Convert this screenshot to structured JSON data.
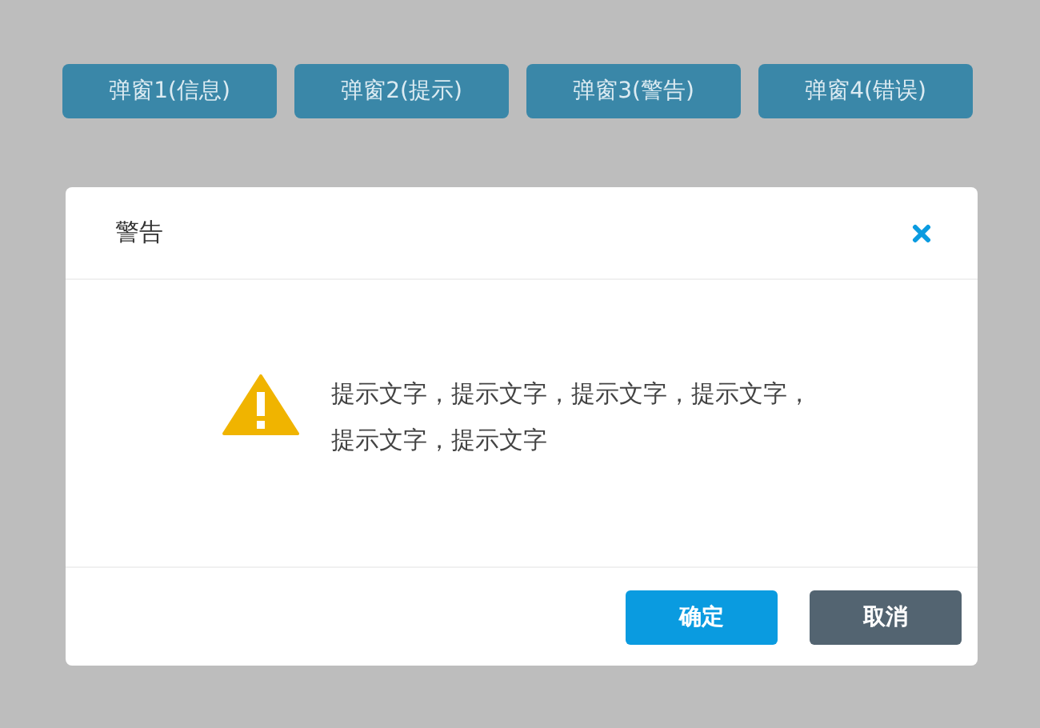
{
  "top_buttons": [
    "弹窗1(信息)",
    "弹窗2(提示)",
    "弹窗3(警告)",
    "弹窗4(错误)"
  ],
  "dialog": {
    "title": "警告",
    "kind": "warning",
    "message": "提示文字，提示文字，提示文字，提示文字，提示文字，提示文字",
    "buttons": [
      {
        "label": "确定",
        "kind": "primary"
      },
      {
        "label": "取消",
        "kind": "secondary"
      }
    ]
  }
}
